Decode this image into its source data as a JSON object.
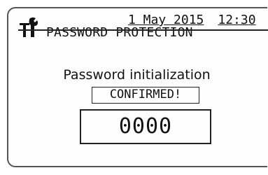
{
  "status_bar": {
    "date": "1 May 2015",
    "time": "12:30"
  },
  "header": {
    "icon": "wrench-screwdriver-icon",
    "title": "PASSWORD PROTECTION"
  },
  "main": {
    "label": "Password initialization",
    "status": "CONFIRMED!",
    "code": "0000"
  }
}
